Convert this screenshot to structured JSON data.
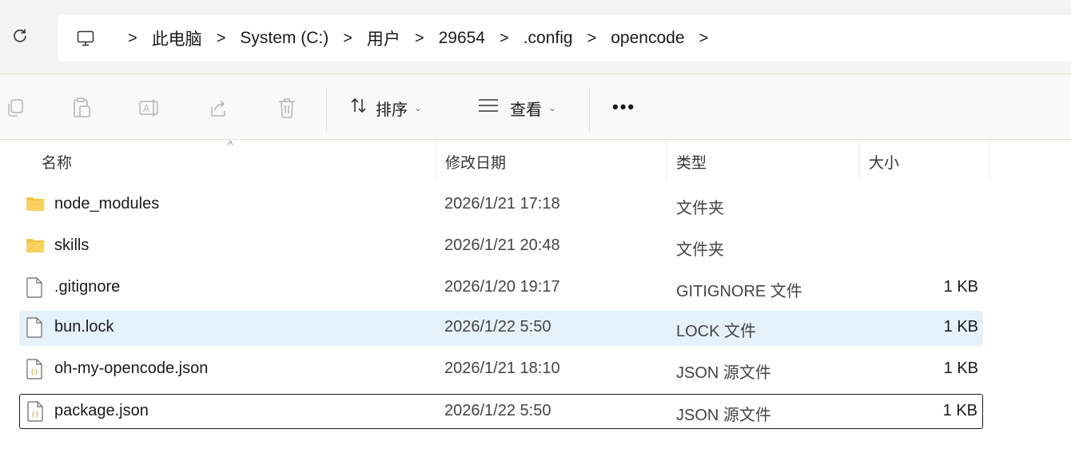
{
  "address": {
    "breadcrumbs": [
      "此电脑",
      "System (C:)",
      "用户",
      "29654",
      ".config",
      "opencode"
    ],
    "separator": ">"
  },
  "toolbar": {
    "icons": [
      "copy-icon",
      "paste-icon",
      "rename-icon",
      "share-icon",
      "delete-icon"
    ],
    "sort_label": "排序",
    "view_label": "查看",
    "more_label": "•••"
  },
  "columns": {
    "name": "名称",
    "modified": "修改日期",
    "type": "类型",
    "size": "大小",
    "sorted_column": "name"
  },
  "files": [
    {
      "name": "node_modules",
      "modified": "2026/1/21 17:18",
      "type": "文件夹",
      "size": "",
      "kind": "folder-icon"
    },
    {
      "name": "skills",
      "modified": "2026/1/21 20:48",
      "type": "文件夹",
      "size": "",
      "kind": "folder-icon"
    },
    {
      "name": ".gitignore",
      "modified": "2026/1/20 19:17",
      "type": "GITIGNORE 文件",
      "size": "1 KB",
      "kind": "file-icon"
    },
    {
      "name": "bun.lock",
      "modified": "2026/1/22 5:50",
      "type": "LOCK 文件",
      "size": "1 KB",
      "kind": "file-icon",
      "state": "selected"
    },
    {
      "name": "oh-my-opencode.json",
      "modified": "2026/1/21 18:10",
      "type": "JSON 源文件",
      "size": "1 KB",
      "kind": "json-file-icon"
    },
    {
      "name": "package.json",
      "modified": "2026/1/22 5:50",
      "type": "JSON 源文件",
      "size": "1 KB",
      "kind": "json-file-icon",
      "state": "focused"
    }
  ],
  "colors": {
    "selected_row": "#e5f1fb",
    "folder": "#f5c33b",
    "focus_outline": "#1a1a1a"
  }
}
